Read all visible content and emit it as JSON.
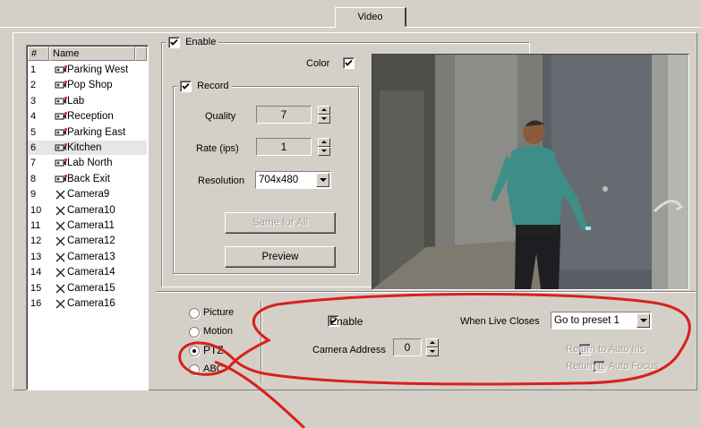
{
  "tab": {
    "label": "Video"
  },
  "camera_list": {
    "headers": [
      "#",
      "Name"
    ],
    "rows": [
      {
        "num": "1",
        "name": "Parking West",
        "icon": "camera-icon"
      },
      {
        "num": "2",
        "name": "Pop Shop",
        "icon": "camera-icon"
      },
      {
        "num": "3",
        "name": "Lab",
        "icon": "camera-icon"
      },
      {
        "num": "4",
        "name": "Reception",
        "icon": "camera-icon"
      },
      {
        "num": "5",
        "name": "Parking East",
        "icon": "camera-icon"
      },
      {
        "num": "6",
        "name": "Kitchen",
        "icon": "camera-icon",
        "selected": true
      },
      {
        "num": "7",
        "name": "Lab North",
        "icon": "camera-icon"
      },
      {
        "num": "8",
        "name": "Back Exit",
        "icon": "camera-icon"
      },
      {
        "num": "9",
        "name": "Camera9",
        "icon": "x-icon"
      },
      {
        "num": "10",
        "name": "Camera10",
        "icon": "x-icon"
      },
      {
        "num": "11",
        "name": "Camera11",
        "icon": "x-icon"
      },
      {
        "num": "12",
        "name": "Camera12",
        "icon": "x-icon"
      },
      {
        "num": "13",
        "name": "Camera13",
        "icon": "x-icon"
      },
      {
        "num": "14",
        "name": "Camera14",
        "icon": "x-icon"
      },
      {
        "num": "15",
        "name": "Camera15",
        "icon": "x-icon"
      },
      {
        "num": "16",
        "name": "Camera16",
        "icon": "x-icon"
      }
    ]
  },
  "enable": {
    "label": "Enable",
    "checked": true
  },
  "color": {
    "label": "Color",
    "checked": true
  },
  "record": {
    "label": "Record",
    "checked": true,
    "quality_label": "Quality",
    "quality_value": "7",
    "rate_label": "Rate (ips)",
    "rate_value": "1",
    "resolution_label": "Resolution",
    "resolution_value": "704x480",
    "same_for_all": "Same for All",
    "preview": "Preview"
  },
  "modes": {
    "picture": "Picture",
    "motion": "Motion",
    "ptz": "PTZ",
    "abc": "ABC",
    "selected": "PTZ"
  },
  "ptz": {
    "enable_label": "Enable",
    "enable_checked": true,
    "camera_address_label": "Camera Address",
    "camera_address_value": "0",
    "when_live_closes_label": "When Live Closes",
    "when_live_closes_value": "Go to preset 1",
    "return_auto_iris": "Return to Auto Iris",
    "return_auto_focus": "Return to Auto Focus"
  },
  "colors": {
    "annotation_red": "#d8201c",
    "dialog_bg": "#d4d0c8"
  }
}
